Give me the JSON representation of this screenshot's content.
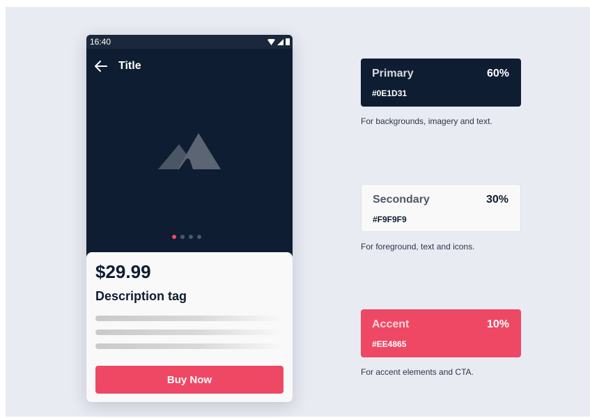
{
  "status_bar": {
    "time": "16:40"
  },
  "app_bar": {
    "title": "Title",
    "back_icon": "arrow-left-icon"
  },
  "carousel": {
    "image_icon": "mountain-image-icon",
    "page_count": 4,
    "active_index": 0
  },
  "product": {
    "price": "$29.99",
    "description": "Description tag",
    "buy_label": "Buy Now"
  },
  "palette": [
    {
      "name": "Primary",
      "percent": "60%",
      "hex": "#0E1D31",
      "caption": "For backgrounds, imagery and text."
    },
    {
      "name": "Secondary",
      "percent": "30%",
      "hex": "#F9F9F9",
      "caption": "For foreground, text and icons."
    },
    {
      "name": "Accent",
      "percent": "10%",
      "hex": "#EE4865",
      "caption": "For accent elements and CTA."
    }
  ],
  "colors": {
    "primary": "#0E1D31",
    "secondary": "#F9F9F9",
    "accent": "#EE4865"
  }
}
